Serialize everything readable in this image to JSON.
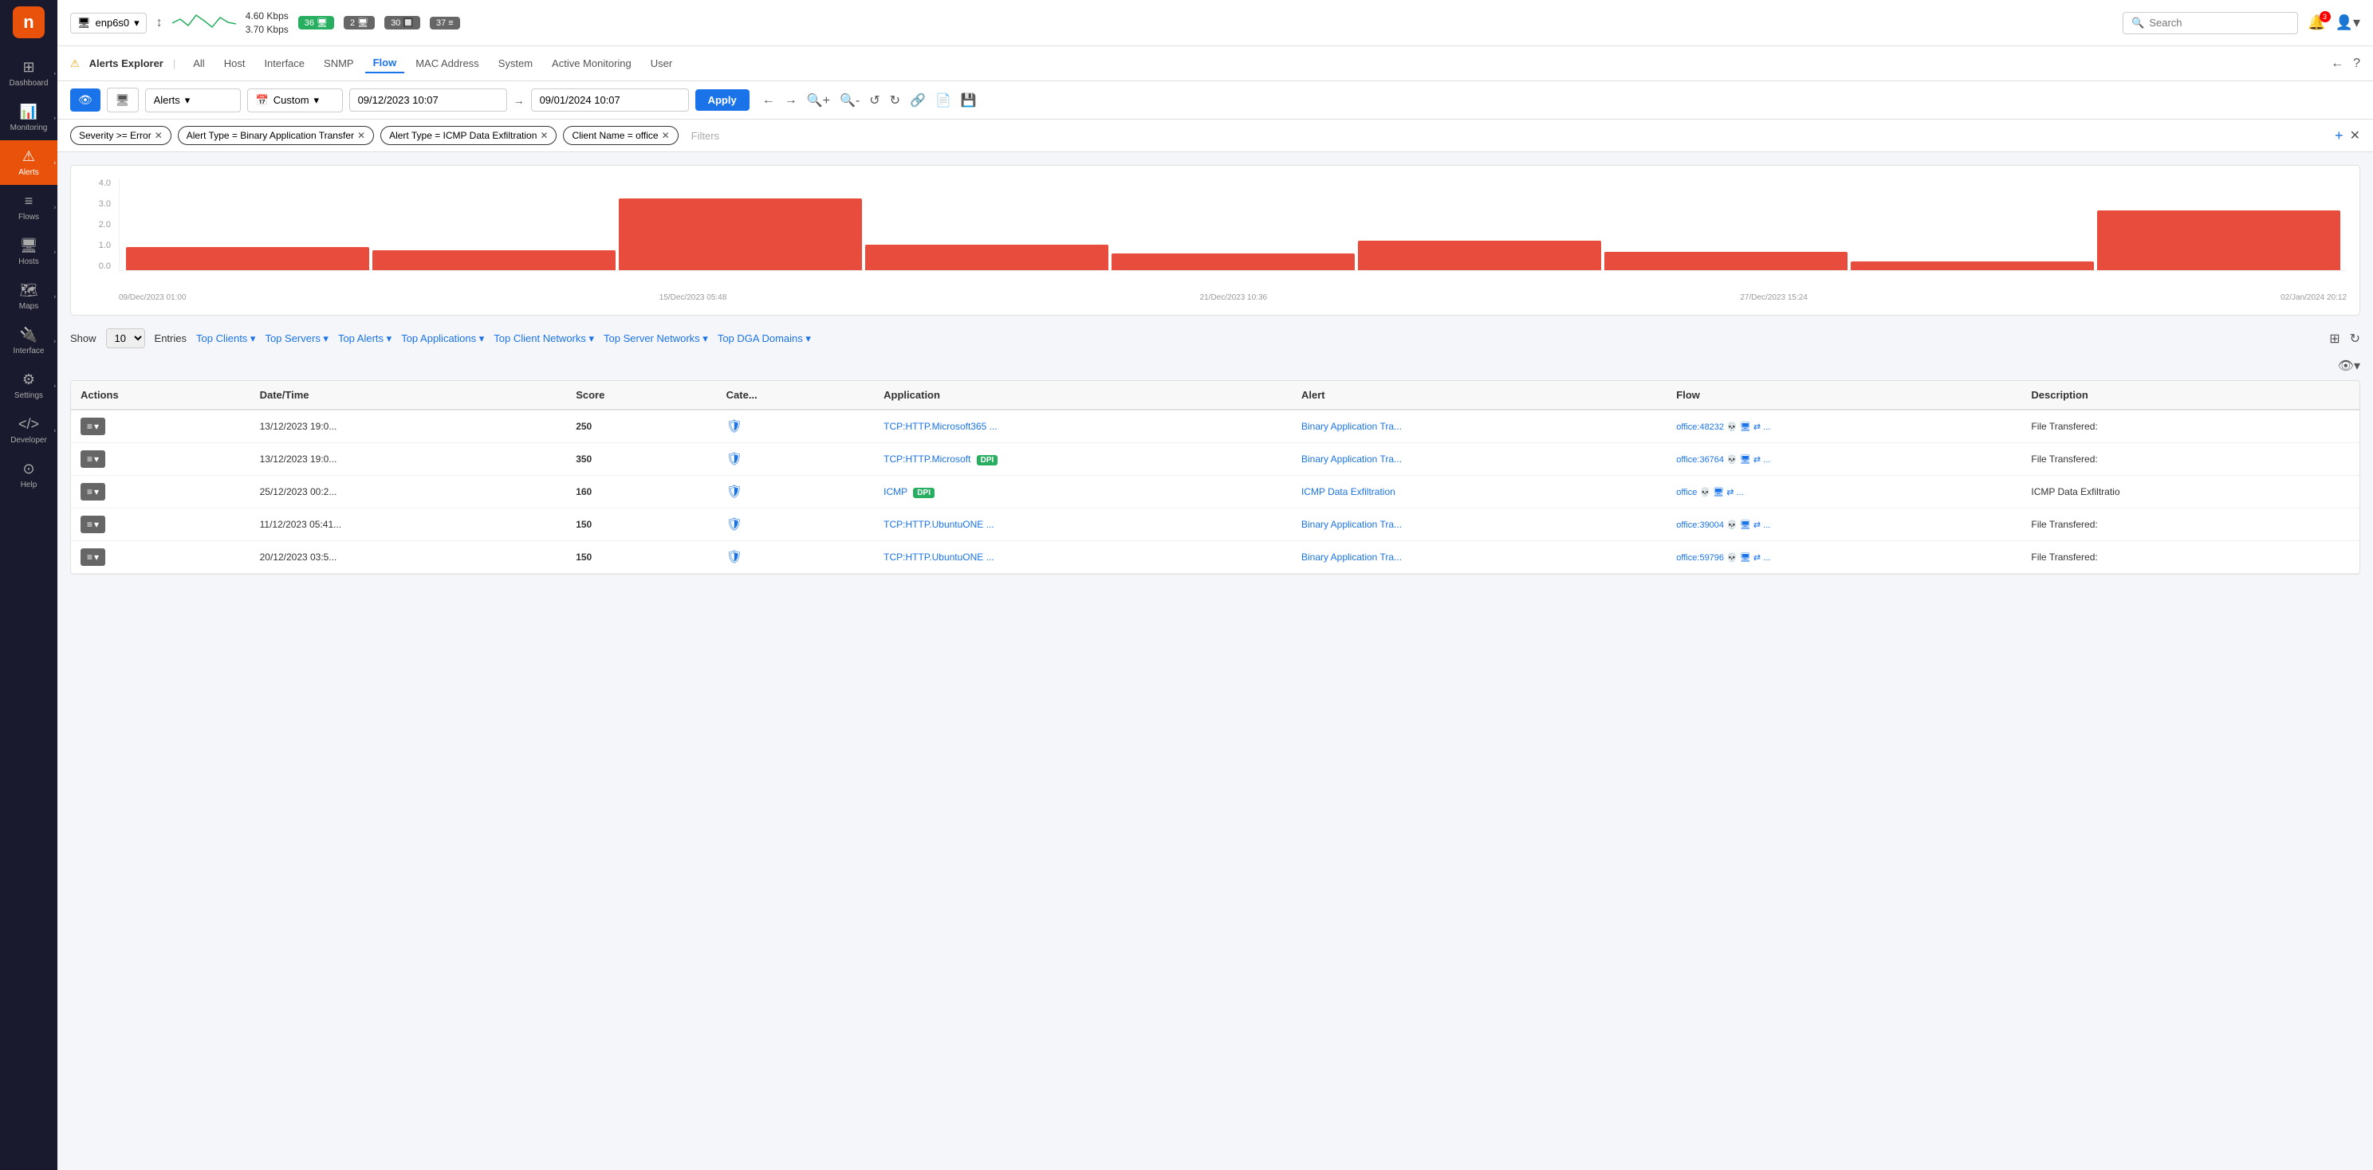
{
  "sidebar": {
    "logo": "n",
    "items": [
      {
        "id": "dashboard",
        "label": "Dashboard",
        "icon": "⊞",
        "active": false
      },
      {
        "id": "monitoring",
        "label": "Monitoring",
        "icon": "📊",
        "active": false
      },
      {
        "id": "alerts",
        "label": "Alerts",
        "icon": "⚠",
        "active": true
      },
      {
        "id": "flows",
        "label": "Flows",
        "icon": "≡",
        "active": false
      },
      {
        "id": "hosts",
        "label": "Hosts",
        "icon": "🖥",
        "active": false
      },
      {
        "id": "maps",
        "label": "Maps",
        "icon": "🗺",
        "active": false
      },
      {
        "id": "interface",
        "label": "Interface",
        "icon": "🔌",
        "active": false
      },
      {
        "id": "settings",
        "label": "Settings",
        "icon": "⚙",
        "active": false
      },
      {
        "id": "developer",
        "label": "Developer",
        "icon": "</>",
        "active": false
      },
      {
        "id": "help",
        "label": "Help",
        "icon": "⊙",
        "active": false
      }
    ]
  },
  "topbar": {
    "interface": {
      "name": "enp6s0",
      "icon": "🖥"
    },
    "traffic": {
      "upload": "4.60 Kbps",
      "download": "3.70 Kbps"
    },
    "badges": [
      {
        "label": "36",
        "icon": "🖥",
        "color": "green"
      },
      {
        "label": "2",
        "icon": "🖥",
        "color": "gray"
      },
      {
        "label": "30",
        "icon": "🔲",
        "color": "gray"
      },
      {
        "label": "37",
        "icon": "≡",
        "color": "gray"
      }
    ],
    "search": {
      "placeholder": "Search"
    },
    "notifications": {
      "count": "3"
    }
  },
  "navtabs": {
    "title": "Alerts Explorer",
    "tabs": [
      {
        "id": "all",
        "label": "All",
        "active": false
      },
      {
        "id": "host",
        "label": "Host",
        "active": false
      },
      {
        "id": "interface",
        "label": "Interface",
        "active": false
      },
      {
        "id": "snmp",
        "label": "SNMP",
        "active": false
      },
      {
        "id": "flow",
        "label": "Flow",
        "active": true
      },
      {
        "id": "mac",
        "label": "MAC Address",
        "active": false
      },
      {
        "id": "system",
        "label": "System",
        "active": false
      },
      {
        "id": "monitoring",
        "label": "Active Monitoring",
        "active": false
      },
      {
        "id": "user",
        "label": "User",
        "active": false
      }
    ]
  },
  "filterbar": {
    "view_label": "👁",
    "monitor_label": "🖥",
    "type_dropdown": "Alerts",
    "time_preset": "Custom",
    "date_from": "09/12/2023 10:07",
    "date_to": "09/01/2024 10:07",
    "apply_label": "Apply"
  },
  "activefilters": {
    "filters": [
      {
        "id": "severity",
        "text": "Severity >= Error"
      },
      {
        "id": "alert_type_1",
        "text": "Alert Type = Binary Application Transfer"
      },
      {
        "id": "alert_type_2",
        "text": "Alert Type = ICMP Data Exfiltration"
      },
      {
        "id": "client_name",
        "text": "Client Name = office"
      }
    ],
    "placeholder": "Filters"
  },
  "chart": {
    "yaxis": [
      "4.0",
      "3.0",
      "2.0",
      "1.0",
      "0.0"
    ],
    "bars": [
      {
        "height_pct": 25,
        "label": ""
      },
      {
        "height_pct": 22,
        "label": ""
      },
      {
        "height_pct": 78,
        "label": ""
      },
      {
        "height_pct": 28,
        "label": ""
      },
      {
        "height_pct": 18,
        "label": ""
      },
      {
        "height_pct": 32,
        "label": ""
      },
      {
        "height_pct": 20,
        "label": ""
      },
      {
        "height_pct": 10,
        "label": ""
      },
      {
        "height_pct": 65,
        "label": ""
      }
    ],
    "xaxis": [
      "09/Dec/2023 01:00",
      "15/Dec/2023 05:48",
      "21/Dec/2023 10:36",
      "27/Dec/2023 15:24",
      "02/Jan/2024 20:12"
    ]
  },
  "table": {
    "show_label": "Show",
    "entries_label": "Entries",
    "show_count": "10",
    "top_buttons": [
      {
        "id": "clients",
        "label": "Top Clients ▾"
      },
      {
        "id": "servers",
        "label": "Top Servers ▾"
      },
      {
        "id": "alerts",
        "label": "Top Alerts ▾"
      },
      {
        "id": "applications",
        "label": "Top Applications ▾"
      },
      {
        "id": "client_networks",
        "label": "Top Client Networks ▾"
      },
      {
        "id": "server_networks",
        "label": "Top Server Networks ▾"
      },
      {
        "id": "dga_domains",
        "label": "Top DGA Domains ▾"
      }
    ],
    "columns": [
      "Actions",
      "Date/Time",
      "Score",
      "Cate...",
      "Application",
      "Alert",
      "Flow",
      "Description"
    ],
    "rows": [
      {
        "actions": "≡▾",
        "datetime": "13/12/2023 19:0...",
        "score": "250",
        "category": "🛡",
        "application": "TCP:HTTP.Microsoft365 ...",
        "alert": "Binary Application Tra...",
        "flow": "office:48232 💀 🖥 ⇄ ...",
        "description": "File Transfered:",
        "dpi": false
      },
      {
        "actions": "≡▾",
        "datetime": "13/12/2023 19:0...",
        "score": "350",
        "category": "🛡",
        "application": "TCP:HTTP.Microsoft",
        "alert": "Binary Application Tra...",
        "flow": "office:36764 💀 🖥 ⇄ ...",
        "description": "File Transfered:",
        "dpi": true
      },
      {
        "actions": "≡▾",
        "datetime": "25/12/2023 00:2...",
        "score": "160",
        "category": "🛡",
        "application": "ICMP",
        "alert": "ICMP Data Exfiltration",
        "flow": "office 💀 🖥 ⇄ ...",
        "description": "ICMP Data Exfiltratio",
        "dpi": true
      },
      {
        "actions": "≡▾",
        "datetime": "11/12/2023 05:41...",
        "score": "150",
        "category": "🛡",
        "application": "TCP:HTTP.UbuntuONE ...",
        "alert": "Binary Application Tra...",
        "flow": "office:39004 💀 🖥 ⇄ ...",
        "description": "File Transfered:",
        "dpi": false
      },
      {
        "actions": "≡▾",
        "datetime": "20/12/2023 03:5...",
        "score": "150",
        "category": "🛡",
        "application": "TCP:HTTP.UbuntuONE ...",
        "alert": "Binary Application Tra...",
        "flow": "office:59796 💀 🖥 ⇄ ...",
        "description": "File Transfered:",
        "dpi": false
      }
    ]
  }
}
